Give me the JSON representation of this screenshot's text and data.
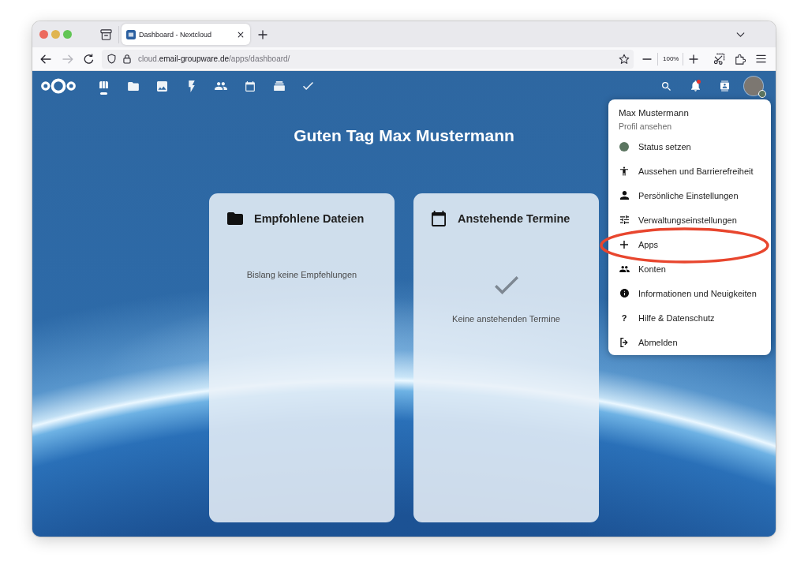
{
  "browser": {
    "tabs": [
      {
        "title": "Dashboard - Nextcloud",
        "selected": true
      }
    ],
    "navigation": [
      {
        "kind": "back",
        "disabled": false
      },
      {
        "kind": "forward",
        "disabled": true
      },
      {
        "kind": "reload",
        "disabled": false
      }
    ],
    "address": {
      "subdomain": "cloud.",
      "domain": "email-groupware.de",
      "path": "/apps/dashboard/"
    },
    "zoom": "100%"
  },
  "header": {
    "apps": [
      {
        "kind": "dashboard",
        "selected": true
      },
      {
        "kind": "files",
        "selected": false
      },
      {
        "kind": "photos",
        "selected": false
      },
      {
        "kind": "activity",
        "selected": false
      },
      {
        "kind": "contacts",
        "selected": false
      },
      {
        "kind": "calendar",
        "selected": false
      },
      {
        "kind": "deck",
        "selected": false
      },
      {
        "kind": "tasks",
        "selected": false
      }
    ],
    "notifications": {
      "unread": true
    },
    "avatar": {
      "status": {
        "color": "#5b7560"
      }
    }
  },
  "greeting": "Guten Tag Max Mustermann",
  "widgets": [
    {
      "kind": "files",
      "title": "Empfohlene Dateien",
      "empty_text": "Bislang keine Empfehlungen"
    },
    {
      "kind": "calendar",
      "title": "Anstehende Termine",
      "empty_text": "Keine anstehenden Termine"
    }
  ],
  "user_menu": {
    "name": "Max Mustermann",
    "profile": "Profil ansehen",
    "items": [
      {
        "kind": "status",
        "label": "Status setzen",
        "color": "#5b7560",
        "highlighted": false
      },
      {
        "kind": "appearance",
        "label": "Aussehen und Barrierefreiheit",
        "highlighted": false
      },
      {
        "kind": "personal",
        "label": "Persönliche Einstellungen",
        "highlighted": false
      },
      {
        "kind": "admin",
        "label": "Verwaltungseinstellungen",
        "highlighted": false
      },
      {
        "kind": "apps",
        "label": "Apps",
        "highlighted": true
      },
      {
        "kind": "accounts",
        "label": "Konten",
        "highlighted": false
      },
      {
        "kind": "info",
        "label": "Informationen und Neuigkeiten",
        "highlighted": false
      },
      {
        "kind": "help",
        "label": "Hilfe & Datenschutz",
        "glyph": "?",
        "highlighted": false
      },
      {
        "kind": "logout",
        "label": "Abmelden",
        "highlighted": false
      }
    ]
  }
}
